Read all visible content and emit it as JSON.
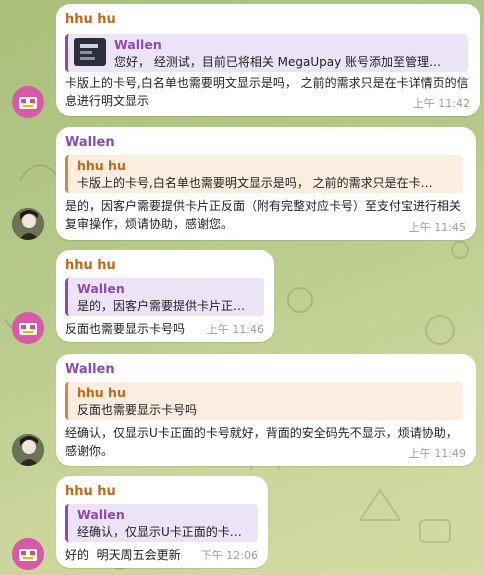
{
  "messages": [
    {
      "sender": "hhu hu",
      "reply": {
        "name": "Wallen",
        "text": "您好， 经测试，目前已将相关 MegaUpay 账号添加至管理…"
      },
      "text": "卡版上的卡号,白名单也需要明文显示是吗， 之前的需求只是在卡详情页的信息进行明文显示",
      "time": "上午 11:42"
    },
    {
      "sender": "Wallen",
      "reply": {
        "name": "hhu hu",
        "text": "卡版上的卡号,白名单也需要明文显示是吗， 之前的需求只是在卡…"
      },
      "text": "是的，因客户需要提供卡片正反面（附有完整对应卡号）至支付宝进行相关复审操作，烦请协助，感谢您。",
      "time": "上午 11:45"
    },
    {
      "sender": "hhu hu",
      "reply": {
        "name": "Wallen",
        "text": "是的，因客户需要提供卡片正…"
      },
      "text": "反面也需要显示卡号吗",
      "time": "上午 11:46"
    },
    {
      "sender": "Wallen",
      "reply": {
        "name": "hhu hu",
        "text": "反面也需要显示卡号吗"
      },
      "text": "经确认，仅显示U卡正面的卡号就好，背面的安全码先不显示，烦请协助，感谢你。",
      "time": "上午 11:49"
    },
    {
      "sender": "hhu hu",
      "reply": {
        "name": "Wallen",
        "text": "经确认，仅显示U卡正面的卡…"
      },
      "text": "好的  明天周五会更新",
      "time": "下午 12:06"
    }
  ],
  "colors": {
    "hhu_hu": "#c06a17",
    "wallen": "#8a4bb5",
    "bubble": "#ffffff"
  },
  "icons": {
    "hhu_hu_avatar": "pink-bot-avatar-icon",
    "wallen_avatar": "person-avatar-icon"
  }
}
